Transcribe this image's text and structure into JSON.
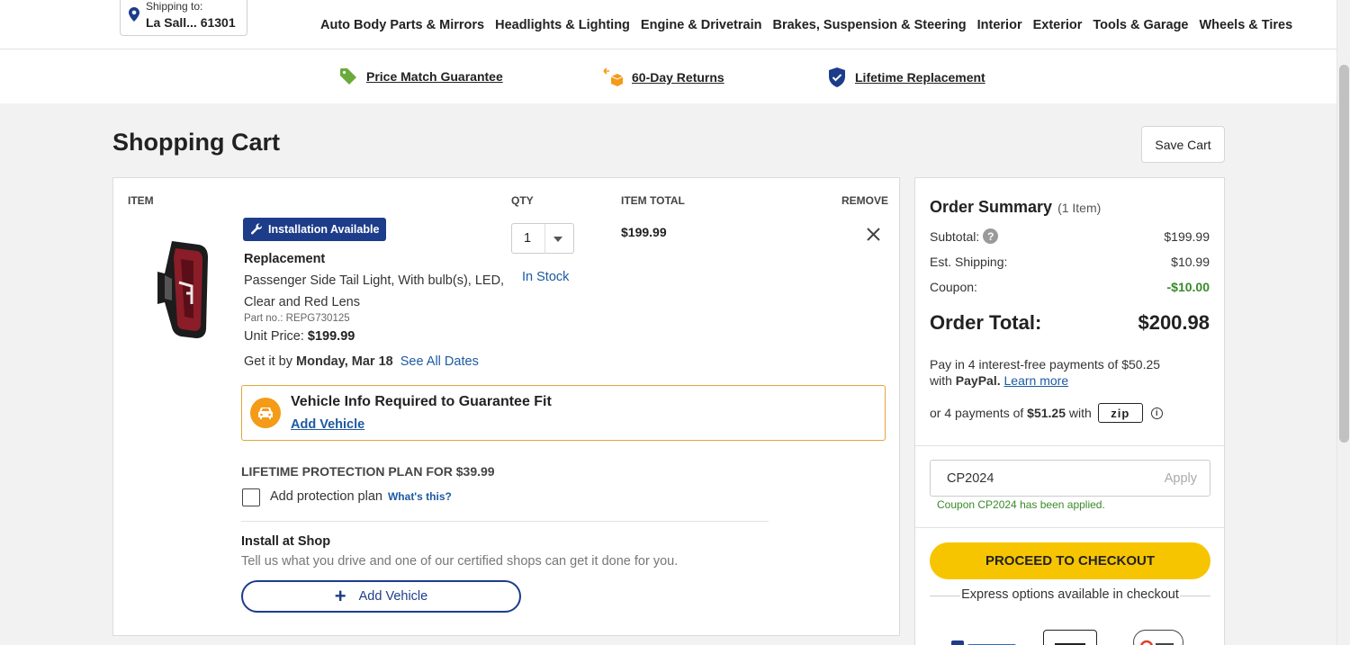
{
  "header": {
    "ship_label": "Shipping to:",
    "ship_value": "La Sall... 61301",
    "nav": [
      "Auto Body Parts & Mirrors",
      "Headlights & Lighting",
      "Engine & Drivetrain",
      "Brakes, Suspension & Steering",
      "Interior",
      "Exterior",
      "Tools & Garage",
      "Wheels & Tires"
    ]
  },
  "benefits": {
    "price_match": "Price Match Guarantee",
    "returns": "60-Day Returns",
    "lifetime": "Lifetime Replacement"
  },
  "page": {
    "title": "Shopping Cart",
    "save_cart": "Save Cart"
  },
  "cart": {
    "col_item": "ITEM",
    "col_qty": "QTY",
    "col_total": "ITEM TOTAL",
    "col_remove": "REMOVE",
    "install_badge": "Installation Available",
    "brand": "Replacement",
    "name": "Passenger Side Tail Light, With bulb(s), LED, Clear and Red Lens",
    "part_no": "Part no.: REPG730125",
    "unit_price_label": "Unit Price:",
    "unit_price": "$199.99",
    "delivery_prefix": "Get it by",
    "delivery_date": "Monday, Mar 18",
    "see_dates": "See All Dates",
    "qty": "1",
    "stock": "In Stock",
    "item_total": "$199.99",
    "fit_title": "Vehicle Info Required to Guarantee Fit",
    "fit_link": "Add Vehicle",
    "plan_title": "LIFETIME PROTECTION PLAN FOR $39.99",
    "plan_label": "Add protection plan",
    "plan_link": "What's this?",
    "shop_title": "Install at Shop",
    "shop_sub": "Tell us what you drive and one of our certified shops can get it done for you.",
    "add_vehicle_btn": "Add Vehicle"
  },
  "summary": {
    "title": "Order Summary",
    "count": "(1 Item)",
    "subtotal_label": "Subtotal:",
    "subtotal": "$199.99",
    "shipping_label": "Est. Shipping:",
    "shipping": "$10.99",
    "coupon_label": "Coupon:",
    "coupon": "-$10.00",
    "total_label": "Order Total:",
    "total": "$200.98",
    "paypal_line1": "Pay in 4 interest-free payments of $50.25",
    "paypal_with": "with",
    "paypal_name": "PayPal.",
    "paypal_link": "Learn more",
    "zip_prefix": "or 4 payments of",
    "zip_amount": "$51.25",
    "zip_with": "with",
    "zip_logo": "zip",
    "coupon_code": "CP2024",
    "apply": "Apply",
    "coupon_msg": "Coupon CP2024 has been applied.",
    "checkout": "PROCEED TO CHECKOUT",
    "express": "Express options available in checkout"
  },
  "colors": {
    "brand_blue": "#1d3c8a",
    "link_blue": "#1d5aa3",
    "checkout_yellow": "#f7c500",
    "success_green": "#3a8a2a",
    "warning_orange": "#f49b18"
  }
}
